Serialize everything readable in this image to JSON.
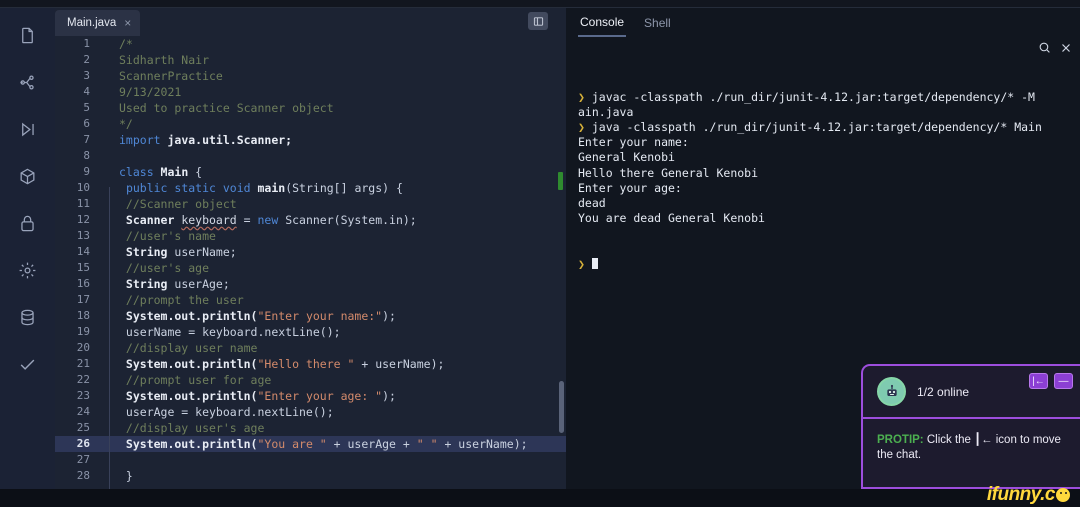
{
  "rail": {
    "items": [
      {
        "icon": "file-icon",
        "name": "files"
      },
      {
        "icon": "git-branch-icon",
        "name": "version-control"
      },
      {
        "icon": "run-icon",
        "name": "run"
      },
      {
        "icon": "package-icon",
        "name": "packages"
      },
      {
        "icon": "lock-icon",
        "name": "secrets"
      },
      {
        "icon": "gear-icon",
        "name": "settings"
      },
      {
        "icon": "database-icon",
        "name": "database"
      },
      {
        "icon": "check-icon",
        "name": "checks"
      }
    ]
  },
  "editor": {
    "tab": {
      "label": "Main.java",
      "close": "×"
    },
    "panel_toggle_icon": "layout-panel-icon",
    "lines": [
      {
        "n": "1",
        "indent": false,
        "tokens": [
          {
            "t": "/*",
            "c": "c-com"
          }
        ]
      },
      {
        "n": "2",
        "indent": false,
        "tokens": [
          {
            "t": "Sidharth Nair",
            "c": "c-com"
          }
        ]
      },
      {
        "n": "3",
        "indent": false,
        "tokens": [
          {
            "t": "ScannerPractice",
            "c": "c-com"
          }
        ]
      },
      {
        "n": "4",
        "indent": false,
        "tokens": [
          {
            "t": "9/13/2021",
            "c": "c-com"
          }
        ]
      },
      {
        "n": "5",
        "indent": false,
        "tokens": [
          {
            "t": "Used to practice Scanner object",
            "c": "c-com"
          }
        ]
      },
      {
        "n": "6",
        "indent": false,
        "tokens": [
          {
            "t": "*/",
            "c": "c-com"
          }
        ]
      },
      {
        "n": "7",
        "indent": false,
        "tokens": [
          {
            "t": "import ",
            "c": "c-kw"
          },
          {
            "t": "java.util.Scanner;",
            "c": "c-bld"
          }
        ]
      },
      {
        "n": "8",
        "indent": false,
        "tokens": []
      },
      {
        "n": "9",
        "indent": false,
        "tokens": [
          {
            "t": "class ",
            "c": "c-kw"
          },
          {
            "t": "Main",
            "c": "c-bld"
          },
          {
            "t": " {",
            "c": "c-pln"
          }
        ]
      },
      {
        "n": "10",
        "indent": true,
        "tokens": [
          {
            "t": " ",
            "c": "c-pln"
          },
          {
            "t": "public static void ",
            "c": "c-kw"
          },
          {
            "t": "main",
            "c": "c-bld"
          },
          {
            "t": "(String[] args) {",
            "c": "c-pln"
          }
        ]
      },
      {
        "n": "11",
        "indent": true,
        "tokens": [
          {
            "t": " //Scanner object",
            "c": "c-com"
          }
        ]
      },
      {
        "n": "12",
        "indent": true,
        "tokens": [
          {
            "t": " Scanner ",
            "c": "c-bld"
          },
          {
            "t": "keyboard",
            "c": "c-squig"
          },
          {
            "t": " = ",
            "c": "c-pln"
          },
          {
            "t": "new ",
            "c": "c-kw"
          },
          {
            "t": "Scanner(System.in);",
            "c": "c-pln"
          }
        ]
      },
      {
        "n": "13",
        "indent": true,
        "tokens": [
          {
            "t": " //user's name",
            "c": "c-com"
          }
        ]
      },
      {
        "n": "14",
        "indent": true,
        "tokens": [
          {
            "t": " String",
            "c": "c-bld"
          },
          {
            "t": " userName;",
            "c": "c-pln"
          }
        ]
      },
      {
        "n": "15",
        "indent": true,
        "tokens": [
          {
            "t": " //user's age",
            "c": "c-com"
          }
        ]
      },
      {
        "n": "16",
        "indent": true,
        "tokens": [
          {
            "t": " String",
            "c": "c-bld"
          },
          {
            "t": " userAge;",
            "c": "c-pln"
          }
        ]
      },
      {
        "n": "17",
        "indent": true,
        "tokens": [
          {
            "t": " //prompt the user",
            "c": "c-com"
          }
        ]
      },
      {
        "n": "18",
        "indent": true,
        "tokens": [
          {
            "t": " System.out.println(",
            "c": "c-bld"
          },
          {
            "t": "\"Enter your name:\"",
            "c": "c-str"
          },
          {
            "t": ");",
            "c": "c-pln"
          }
        ]
      },
      {
        "n": "19",
        "indent": true,
        "tokens": [
          {
            "t": " userName = keyboard.nextLine();",
            "c": "c-pln"
          }
        ]
      },
      {
        "n": "20",
        "indent": true,
        "tokens": [
          {
            "t": " //display user name",
            "c": "c-com"
          }
        ]
      },
      {
        "n": "21",
        "indent": true,
        "tokens": [
          {
            "t": " System.out.println(",
            "c": "c-bld"
          },
          {
            "t": "\"Hello there \"",
            "c": "c-str"
          },
          {
            "t": " + userName);",
            "c": "c-pln"
          }
        ]
      },
      {
        "n": "22",
        "indent": true,
        "tokens": [
          {
            "t": " //prompt user for age",
            "c": "c-com"
          }
        ]
      },
      {
        "n": "23",
        "indent": true,
        "tokens": [
          {
            "t": " System.out.println(",
            "c": "c-bld"
          },
          {
            "t": "\"Enter your age: \"",
            "c": "c-str"
          },
          {
            "t": ");",
            "c": "c-pln"
          }
        ]
      },
      {
        "n": "24",
        "indent": true,
        "tokens": [
          {
            "t": " userAge = keyboard.nextLine();",
            "c": "c-pln"
          }
        ]
      },
      {
        "n": "25",
        "indent": true,
        "tokens": [
          {
            "t": " //display user's age",
            "c": "c-com"
          }
        ]
      },
      {
        "n": "26",
        "indent": true,
        "highlight": true,
        "tokens": [
          {
            "t": " System.out.println(",
            "c": "c-bld"
          },
          {
            "t": "\"You are \"",
            "c": "c-str"
          },
          {
            "t": " + userAge + ",
            "c": "c-pln"
          },
          {
            "t": "\" \"",
            "c": "c-str"
          },
          {
            "t": " + userName);",
            "c": "c-pln"
          }
        ]
      },
      {
        "n": "27",
        "indent": true,
        "tokens": []
      },
      {
        "n": "28",
        "indent": true,
        "tokens": [
          {
            "t": " }",
            "c": "c-pln"
          }
        ]
      }
    ]
  },
  "console": {
    "tabs": [
      {
        "label": "Console",
        "active": true
      },
      {
        "label": "Shell",
        "active": false
      }
    ],
    "actions": [
      {
        "icon": "search-icon",
        "name": "console-search"
      },
      {
        "icon": "close-icon",
        "name": "console-close"
      }
    ],
    "output": [
      {
        "prompt": true,
        "text": "javac -classpath ./run_dir/junit-4.12.jar:target/dependency/* -M"
      },
      {
        "prompt": false,
        "text": "ain.java"
      },
      {
        "prompt": true,
        "text": "java -classpath ./run_dir/junit-4.12.jar:target/dependency/* Main"
      },
      {
        "prompt": false,
        "text": "Enter your name:"
      },
      {
        "prompt": false,
        "text": "General Kenobi"
      },
      {
        "prompt": false,
        "text": "Hello there General Kenobi"
      },
      {
        "prompt": false,
        "text": "Enter your age:"
      },
      {
        "prompt": false,
        "text": "dead"
      },
      {
        "prompt": false,
        "text": "You are dead General Kenobi"
      }
    ],
    "final_prompt": "❯"
  },
  "chat": {
    "avatar_icon": "robot-avatar-icon",
    "online_status": "1/2 online",
    "buttons": [
      {
        "icon": "move-left-icon",
        "glyph": "|←",
        "name": "move-chat-button"
      },
      {
        "icon": "minimize-icon",
        "glyph": "—",
        "name": "minimize-chat-button"
      }
    ],
    "protip_label": "PROTIP:",
    "protip_text": " Click the ┃← icon to move the chat."
  },
  "watermark": {
    "text": "ifunny.c"
  },
  "colors": {
    "editor_bg": "#1c2333",
    "rail_bg": "#1b2235",
    "console_bg": "#11161f",
    "accent_purple": "#9d4edd",
    "comment_green": "#6f7f5c",
    "keyword_blue": "#4f87d6",
    "string_orange": "#d38a6b",
    "prompt_yellow": "#d8b23a",
    "highlight_line": "#2d3657",
    "watermark_yellow": "#ffd83d"
  }
}
